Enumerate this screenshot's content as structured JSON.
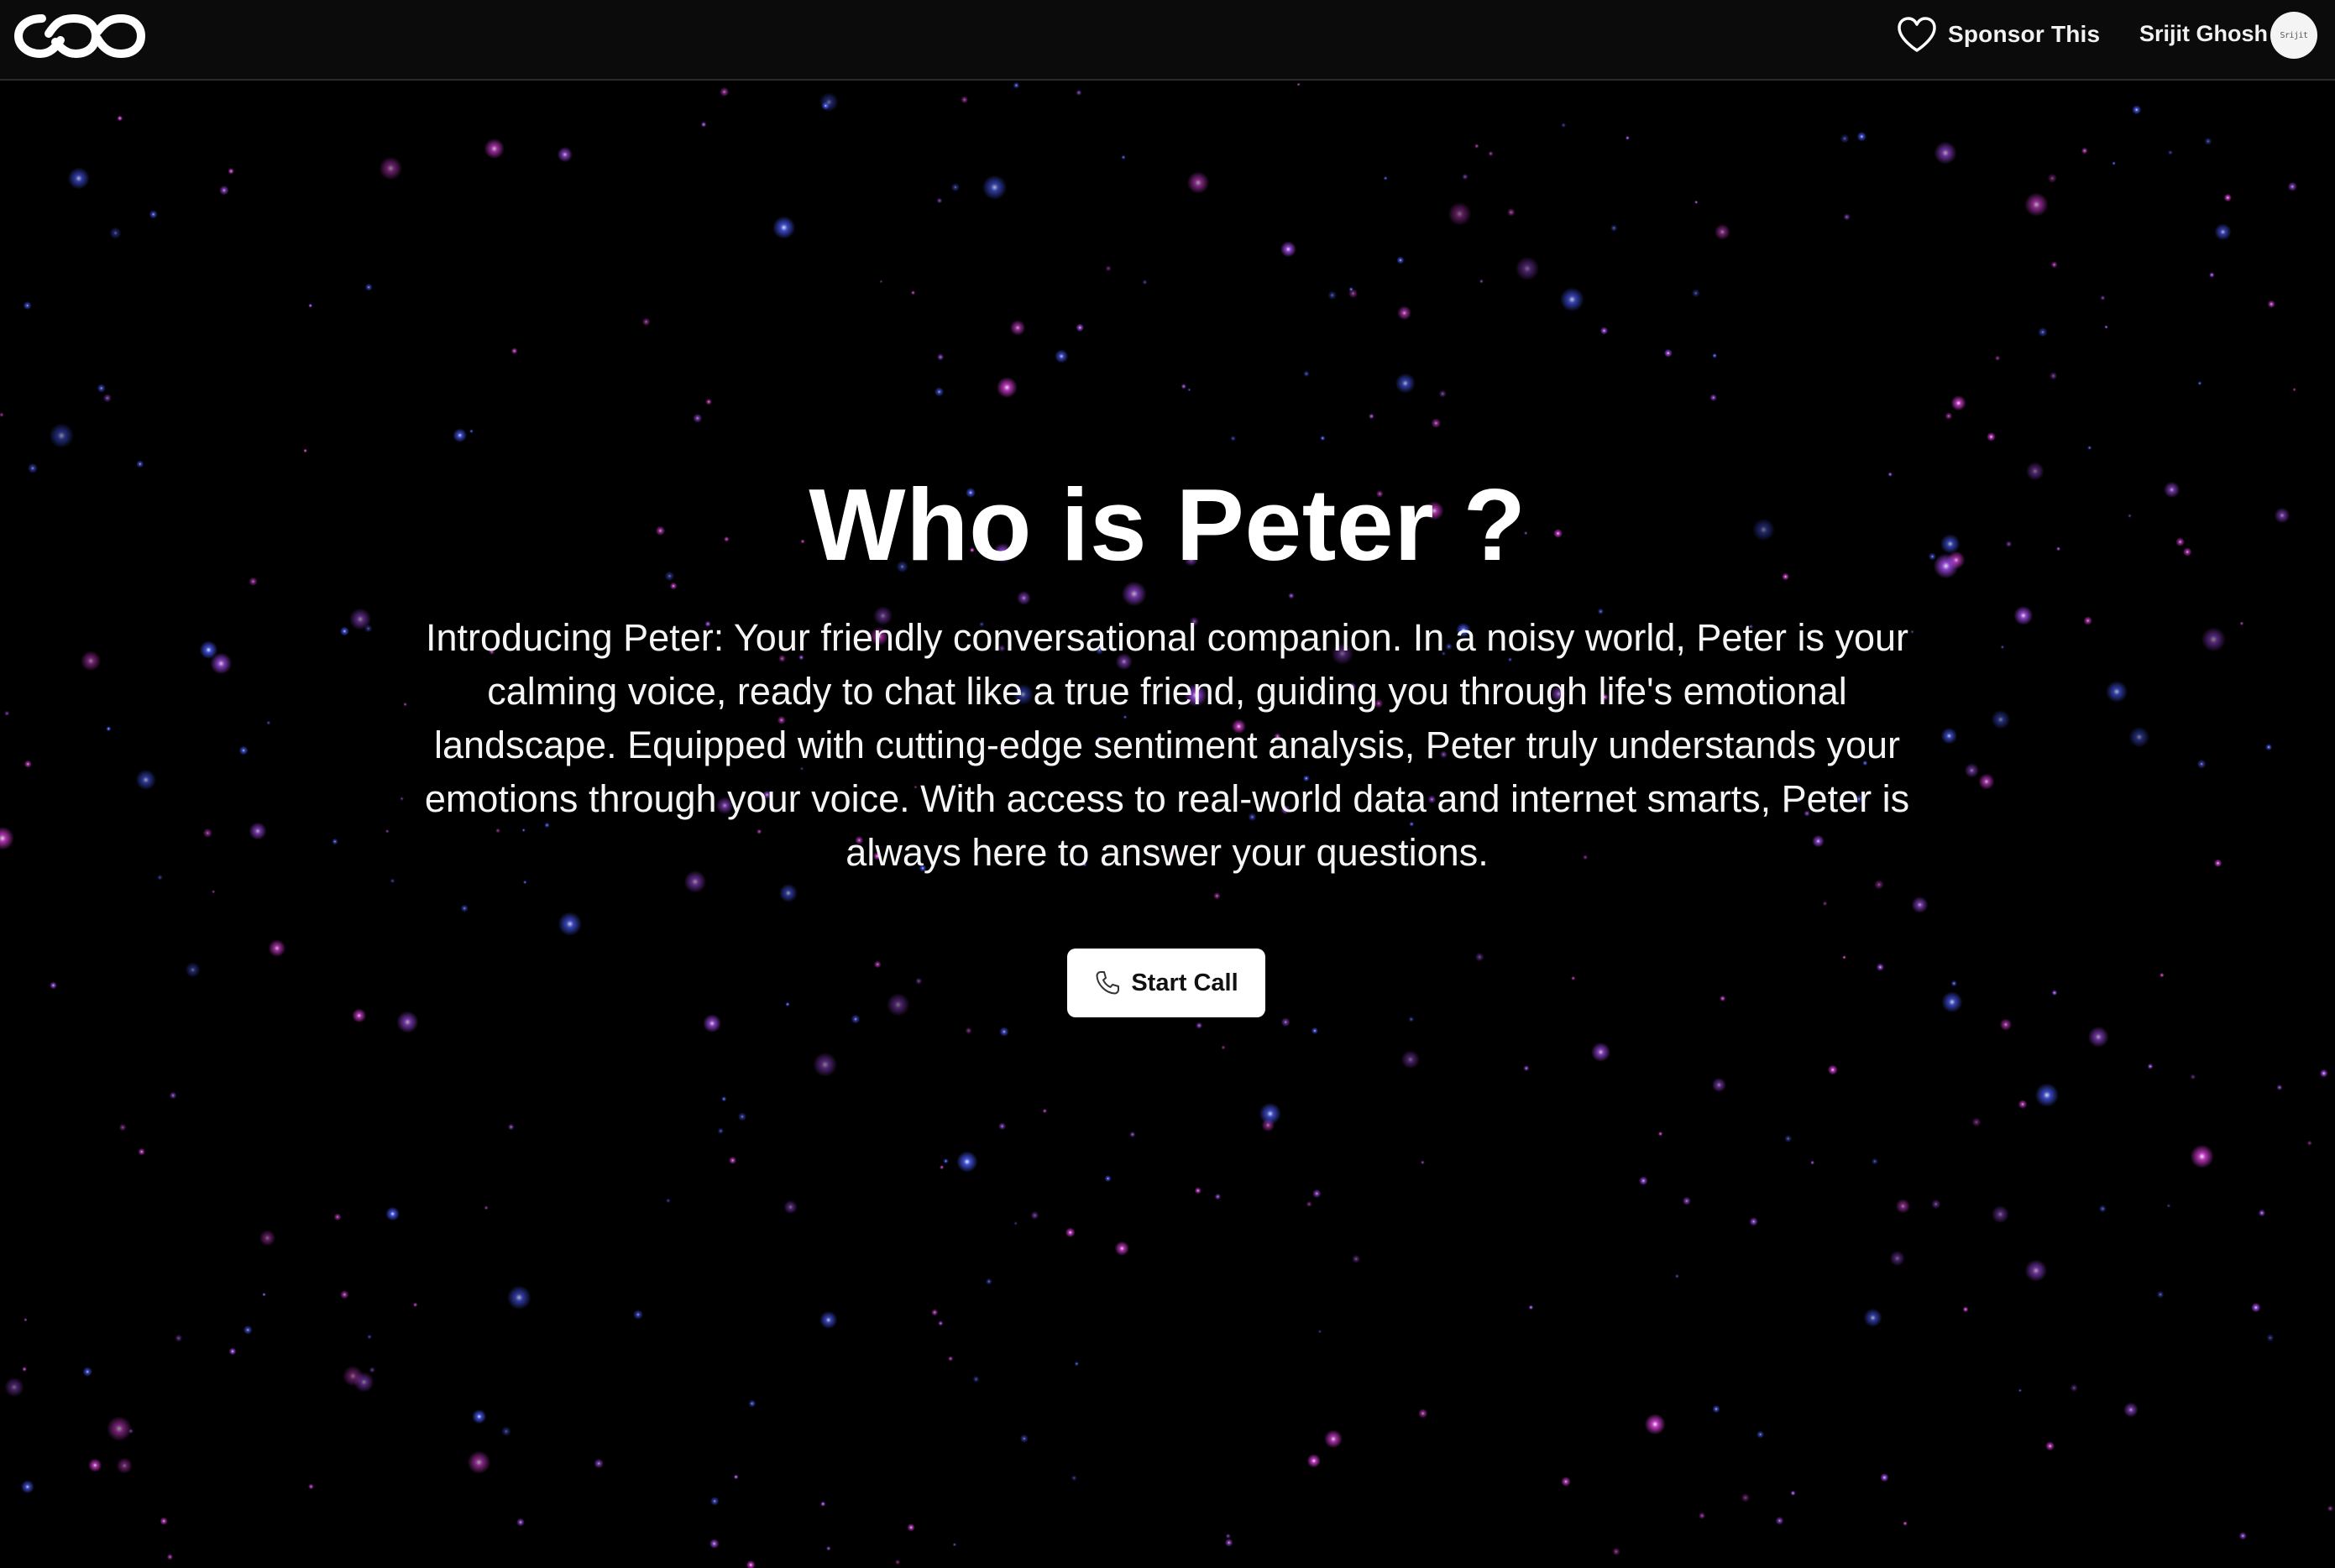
{
  "navbar": {
    "logo_icon": "infinity-links-logo-icon",
    "sponsor_icon": "heart-icon",
    "sponsor_label": "Sponsor This",
    "user_name": "Srijit Ghosh",
    "avatar_text": "Srijit"
  },
  "hero": {
    "title": "Who is Peter ?",
    "description": "Introducing Peter: Your friendly conversational companion. In a noisy world, Peter is your calming voice, ready to chat like a true friend, guiding you through life's emotional landscape. Equipped with cutting-edge sentiment analysis, Peter truly understands your emotions through your voice. With access to real-world data and internet smarts, Peter is always here to answer your questions.",
    "cta_icon": "phone-icon",
    "cta_label": "Start Call"
  },
  "colors": {
    "background": "#000000",
    "navbar": "#0b0b0c",
    "star_pink": "#e040e0",
    "star_blue": "#4a5cff",
    "button_bg": "#ffffff",
    "text": "#ffffff"
  }
}
